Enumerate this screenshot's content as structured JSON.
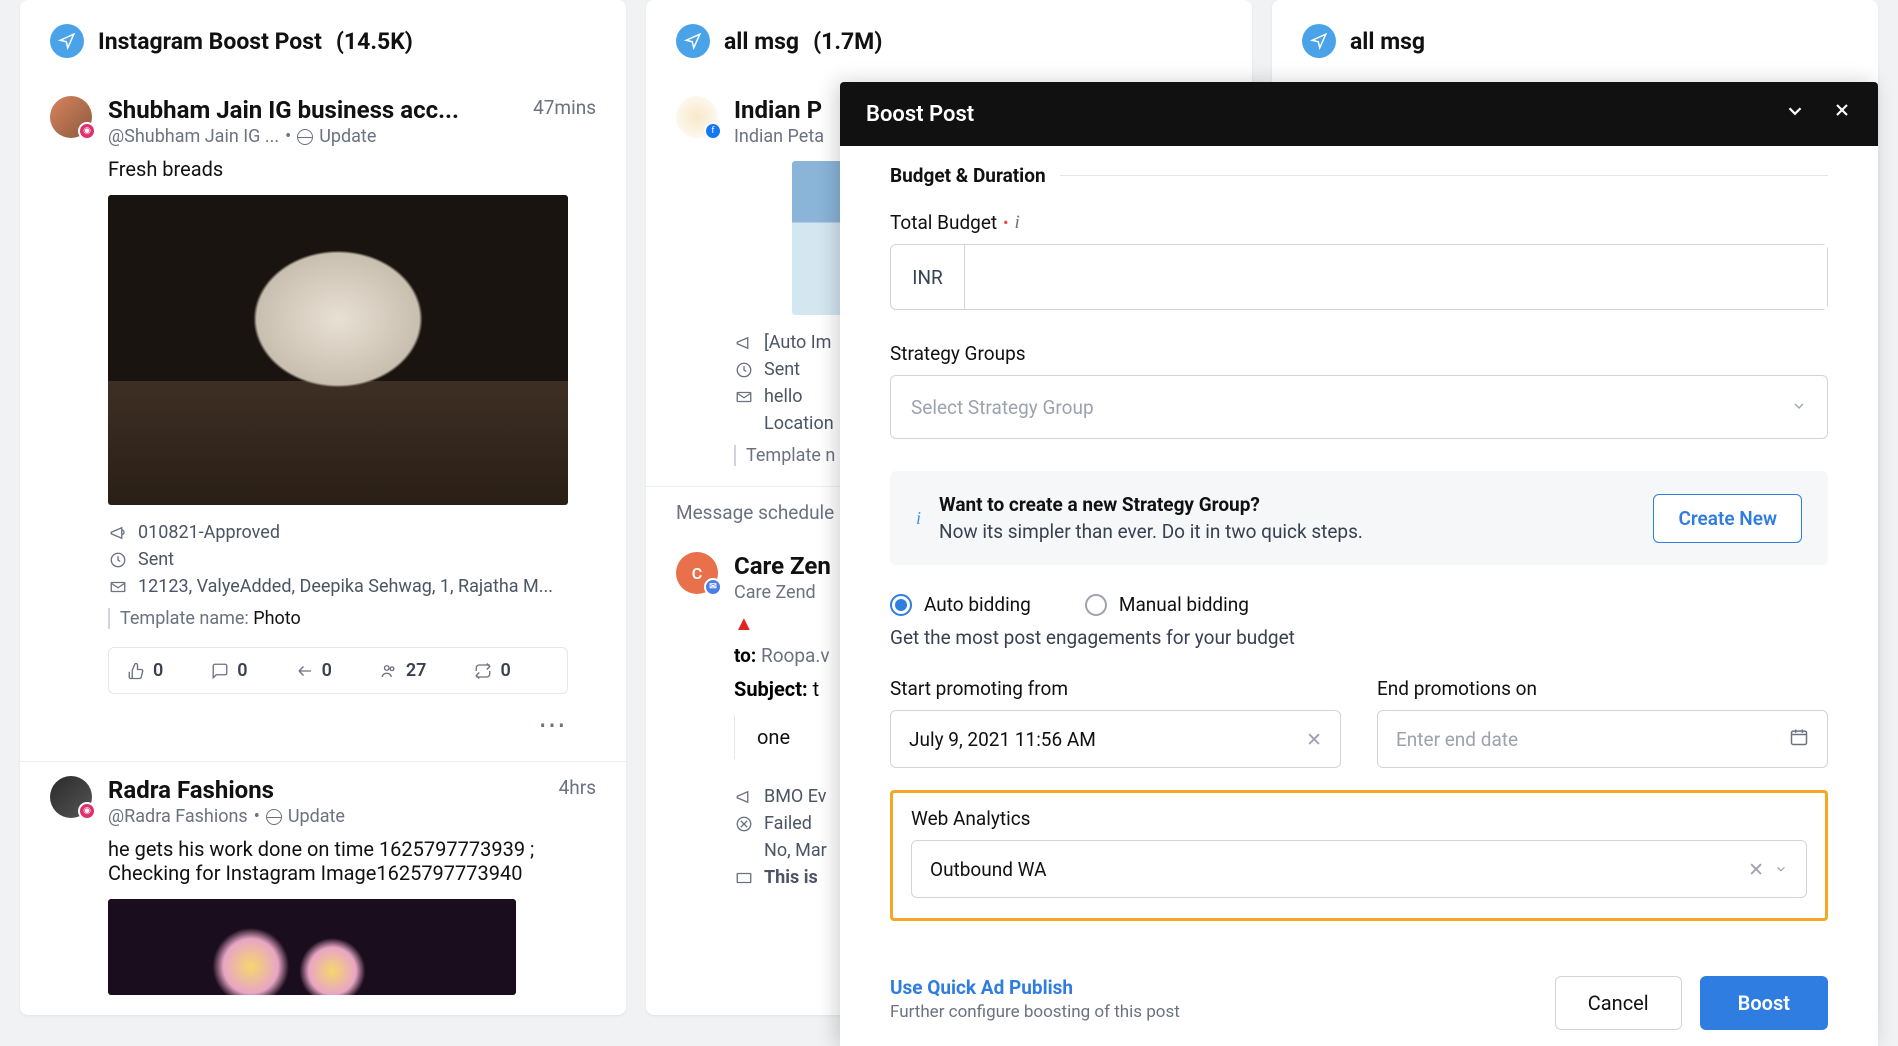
{
  "columns": [
    {
      "title": "Instagram Boost Post",
      "count": "(14.5K)"
    },
    {
      "title": "all msg",
      "count": "(1.7M)"
    },
    {
      "title": "all msg",
      "count": ""
    }
  ],
  "post1": {
    "author": "Shubham Jain IG business acc...",
    "handle": "@Shubham Jain IG ...",
    "dot": "•",
    "update": "Update",
    "time": "47mins",
    "body": "Fresh breads",
    "meta_approved": "010821-Approved",
    "meta_sent": "Sent",
    "meta_names": "12123, ValyeAdded, Deepika Sehwag, 1, Rajatha M...",
    "template_label": "Template name:",
    "template_value": "Photo",
    "stats": {
      "like": "0",
      "comment": "0",
      "share": "0",
      "group": "27",
      "repost": "0"
    }
  },
  "post2": {
    "author": "Radra Fashions",
    "handle": "@Radra Fashions",
    "dot": "•",
    "update": "Update",
    "time": "4hrs",
    "body": "he gets his work done on time 1625797773939 ; Checking for Instagram Image1625797773940"
  },
  "post3": {
    "author": "Indian P",
    "sub": "Indian Peta",
    "auto": "[Auto Im",
    "sent": "Sent",
    "hello": "hello",
    "location": "Location",
    "template": "Template n"
  },
  "schedule_label": "Message schedule",
  "post4": {
    "author": "Care Zen",
    "sub": "Care Zend",
    "to_label": "to:",
    "to": "Roopa.v",
    "subject_label": "Subject:",
    "subject": "t",
    "one": "one",
    "bmo": "BMO Ev",
    "failed": "Failed",
    "nomar": "No, Mar",
    "thisis": "This is"
  },
  "modal": {
    "title": "Boost Post",
    "section": "Budget & Duration",
    "budget_label": "Total Budget",
    "currency": "INR",
    "strategy_label": "Strategy Groups",
    "strategy_placeholder": "Select Strategy Group",
    "banner_title": "Want to create a new Strategy Group?",
    "banner_sub": "Now its simpler than ever. Do it in two quick steps.",
    "create_new": "Create New",
    "auto_bidding": "Auto bidding",
    "manual_bidding": "Manual bidding",
    "bidding_help": "Get the most post engagements for your budget",
    "start_label": "Start promoting from",
    "start_value": "July 9, 2021 11:56 AM",
    "end_label": "End promotions on",
    "end_placeholder": "Enter end date",
    "wa_label": "Web Analytics",
    "wa_value": "Outbound WA",
    "quick_link": "Use Quick Ad Publish",
    "quick_sub": "Further configure boosting of this post",
    "cancel": "Cancel",
    "boost": "Boost"
  }
}
